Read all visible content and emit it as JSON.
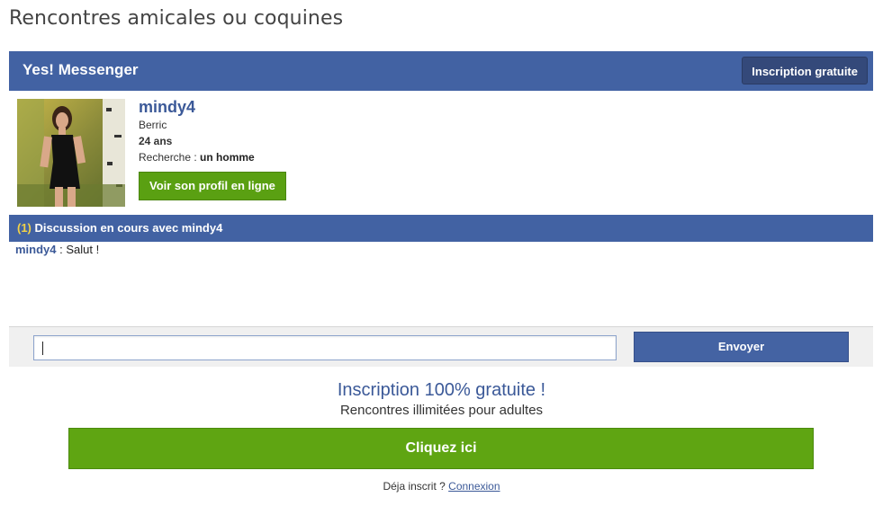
{
  "page": {
    "title": "Rencontres amicales ou coquines"
  },
  "header": {
    "app_name": "Yes! Messenger",
    "signup_label": "Inscription gratuite"
  },
  "profile": {
    "name": "mindy4",
    "city": "Berric",
    "age": "24 ans",
    "search_label": "Recherche : ",
    "search_value": "un homme",
    "button_label": "Voir son profil en ligne"
  },
  "discussion": {
    "count": "(1)",
    "title": " Discussion en cours avec mindy4",
    "messages": [
      {
        "author": "mindy4",
        "separator": " : ",
        "text": "Salut !"
      }
    ]
  },
  "composer": {
    "value": "",
    "send_label": "Envoyer"
  },
  "promo": {
    "title": "Inscription 100% gratuite !",
    "subtitle": "Rencontres illimitées pour adultes",
    "cta_label": "Cliquez ici",
    "login_prefix": "Déja inscrit ? ",
    "login_link": "Connexion"
  },
  "colors": {
    "brand_blue": "#4262a3",
    "green": "#5fa512",
    "count_yellow": "#f2d247"
  }
}
